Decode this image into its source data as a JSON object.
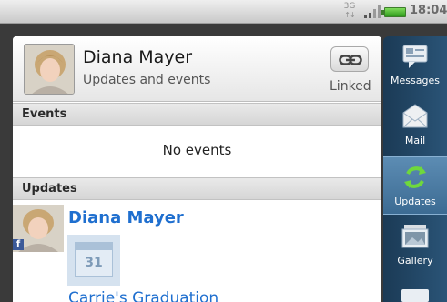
{
  "status_bar": {
    "network": "3G",
    "time": "18:04"
  },
  "contact": {
    "name": "Diana Mayer",
    "subtitle": "Updates and events",
    "link_status": "Linked"
  },
  "events": {
    "header": "Events",
    "empty_text": "No events"
  },
  "updates": {
    "header": "Updates",
    "items": [
      {
        "name": "Diana Mayer",
        "source_badge": "f",
        "calendar_day": "31",
        "event_title": "Carrie's Graduation"
      }
    ]
  },
  "tabs": [
    {
      "label": "Messages",
      "icon": "messages-icon",
      "active": false
    },
    {
      "label": "Mail",
      "icon": "mail-icon",
      "active": false
    },
    {
      "label": "Updates",
      "icon": "updates-icon",
      "active": true
    },
    {
      "label": "Gallery",
      "icon": "gallery-icon",
      "active": false
    }
  ],
  "colors": {
    "link_blue": "#1f6fcf",
    "tab_bar": "#1b3a55",
    "tab_active": "#5c8cb3",
    "battery": "#2f9a1c",
    "facebook": "#3b5998"
  }
}
